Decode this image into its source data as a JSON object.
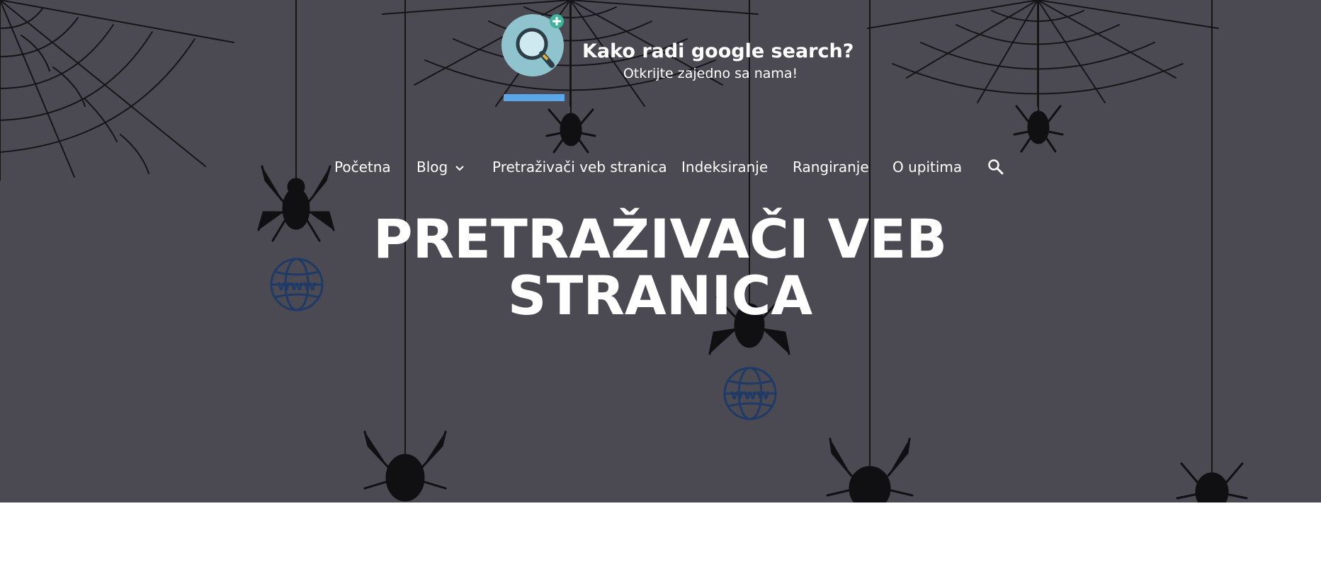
{
  "site": {
    "title": "Kako radi google search?",
    "tagline": "Otkrijte zajedno sa nama!",
    "logo_icon": "magnifier-logo-icon"
  },
  "nav": {
    "items": [
      {
        "label": "Početna"
      },
      {
        "label": "Blog",
        "has_dropdown": true
      },
      {
        "label": "Pretraživači veb stranica"
      },
      {
        "label": "Indeksiranje"
      },
      {
        "label": "Rangiranje"
      },
      {
        "label": "O upitima"
      }
    ],
    "search_icon": "search-icon"
  },
  "hero": {
    "heading": "PRETRAŽIVAČI VEB STRANICA",
    "background_color": "#4b4a52",
    "decor_globe_label": "www"
  }
}
